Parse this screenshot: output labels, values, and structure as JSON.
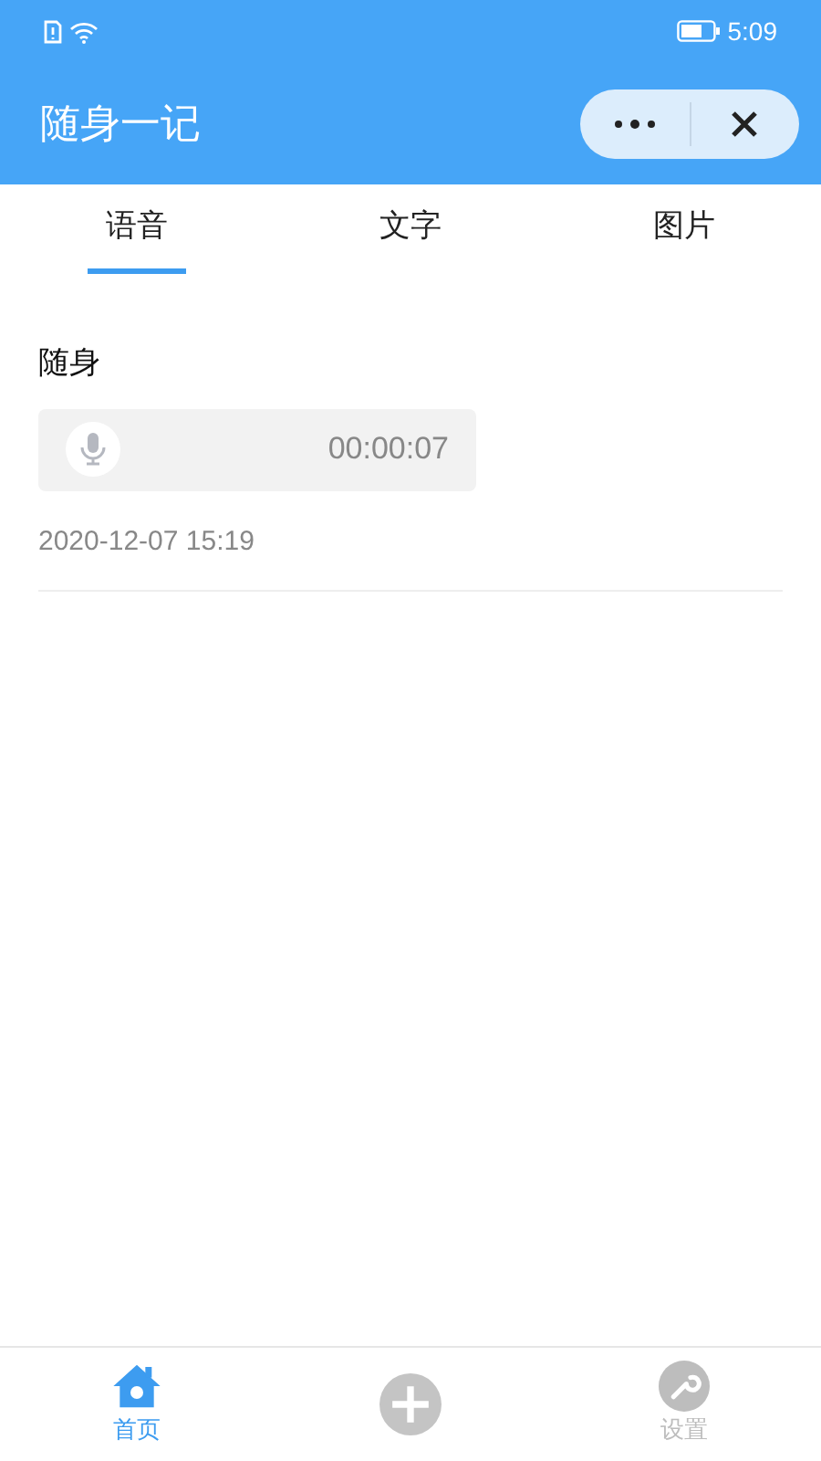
{
  "status_bar": {
    "time": "5:09"
  },
  "header": {
    "title": "随身一记"
  },
  "tabs": [
    {
      "label": "语音",
      "selected": true
    },
    {
      "label": "文字",
      "selected": false
    },
    {
      "label": "图片",
      "selected": false
    }
  ],
  "records": [
    {
      "title": "随身",
      "duration": "00:00:07",
      "date": "2020-12-07 15:19"
    }
  ],
  "bottom_nav": [
    {
      "kind": "home",
      "label": "首页",
      "selected": true
    },
    {
      "kind": "add",
      "selected": false
    },
    {
      "kind": "settings",
      "label": "设置",
      "selected": false
    }
  ]
}
